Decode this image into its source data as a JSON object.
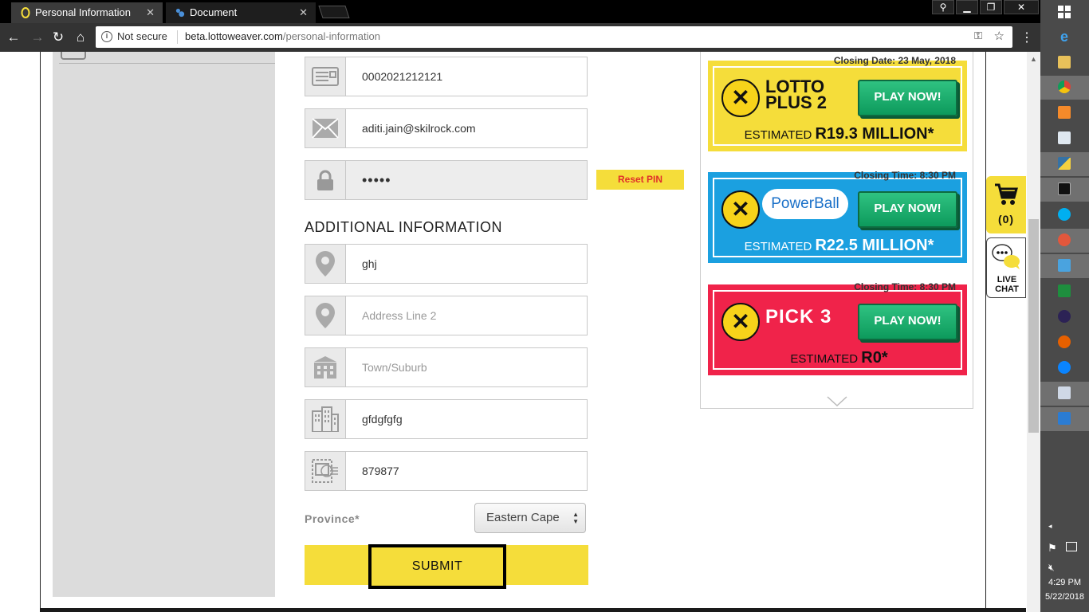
{
  "browser": {
    "tabs": [
      {
        "title": "Personal Information",
        "active": true
      },
      {
        "title": "Document",
        "active": false
      }
    ],
    "security_label": "Not secure",
    "url_host": "beta.lottoweaver.com",
    "url_path": "/personal-information"
  },
  "form": {
    "id_number": "0002021212121",
    "email": "aditi.jain@skilrock.com",
    "pin_masked": "•••••",
    "reset_pin_label": "Reset PIN",
    "additional_title": "ADDITIONAL INFORMATION",
    "address_line_1": "ghj",
    "address_line_2_placeholder": "Address Line 2",
    "town_placeholder": "Town/Suburb",
    "city": "gfdgfgfg",
    "postal_code": "879877",
    "province_label": "Province*",
    "province_value": "Eastern Cape",
    "submit_label": "SUBMIT"
  },
  "games": [
    {
      "closing": "Closing Date: 23 May, 2018",
      "name": "LOTTO PLUS 2",
      "play": "PLAY NOW!",
      "estimate_prefix": "ESTIMATED",
      "estimate_value": "R19.3 MILLION*",
      "color": "#f5dd3a",
      "text_color": "#111111"
    },
    {
      "closing": "Closing Time: 8:30 PM",
      "name": "PowerBall",
      "play": "PLAY NOW!",
      "estimate_prefix": "ESTIMATED",
      "estimate_value": "R22.5 MILLION*",
      "color": "#1ba0e0",
      "text_color": "#ffffff"
    },
    {
      "closing": "Closing Time: 8:30 PM",
      "name": "PICK 3",
      "play": "PLAY NOW!",
      "estimate_prefix": "ESTIMATED",
      "estimate_value": "R0*",
      "color": "#f0234a",
      "text_color": "#111111"
    }
  ],
  "cart": {
    "count": "(0)"
  },
  "chat": {
    "label_1": "LIVE",
    "label_2": "CHAT"
  },
  "taskbar": {
    "time": "4:29 PM",
    "date": "5/22/2018"
  },
  "icons": [
    "id-card-icon",
    "envelope-icon",
    "lock-icon",
    "location-pin-icon",
    "building-icon",
    "city-icon",
    "stamp-icon",
    "cart-icon",
    "chat-icon"
  ]
}
